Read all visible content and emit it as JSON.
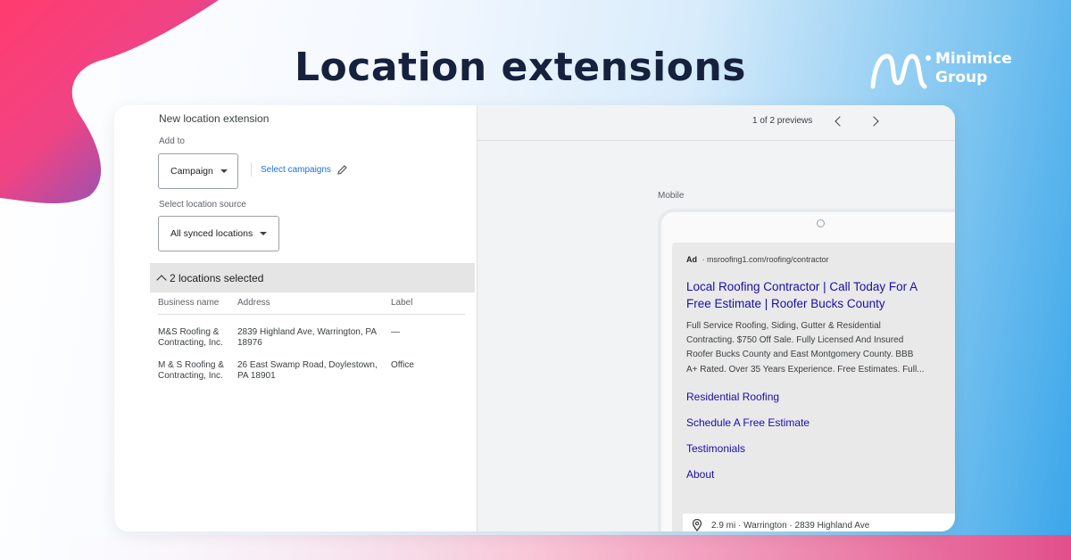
{
  "headline": "Location extensions",
  "brand": {
    "line1": "Minimice",
    "line2": "Group"
  },
  "left_panel": {
    "title": "New location extension",
    "add_to_label": "Add to",
    "campaign_dropdown": "Campaign",
    "select_campaigns_link": "Select campaigns",
    "location_source_label": "Select location source",
    "location_source_dropdown": "All synced locations",
    "locations_selected": "2 locations selected",
    "table": {
      "headers": [
        "Business name",
        "Address",
        "Label"
      ],
      "rows": [
        {
          "name_l1": "M&S Roofing &",
          "name_l2": "Contracting, Inc.",
          "addr_l1": "2839 Highland Ave, Warrington, PA",
          "addr_l2": "18976",
          "label": "—"
        },
        {
          "name_l1": "M & S Roofing &",
          "name_l2": "Contracting, Inc.",
          "addr_l1": "26 East Swamp Road, Doylestown,",
          "addr_l2": "PA 18901",
          "label": "Office"
        }
      ]
    }
  },
  "right_panel": {
    "preview_counter": "1 of 2 previews",
    "device_label": "Mobile",
    "ad": {
      "badge": "Ad",
      "url": "· msroofing1.com/roofing/contractor",
      "headline_l1": "Local Roofing Contractor | Call Today For A",
      "headline_l2": "Free Estimate | Roofer Bucks County",
      "desc_l1": "Full Service Roofing, Siding, Gutter & Residential",
      "desc_l2": "Contracting. $750 Off Sale. Fully Licensed And Insured",
      "desc_l3": "Roofer Bucks County and East Montgomery County. BBB",
      "desc_l4": "A+ Rated. Over 35 Years Experience. Free Estimates. Full...",
      "sitelinks": [
        "Residential Roofing",
        "Schedule A Free Estimate",
        "Testimonials",
        "About"
      ],
      "location": "2.9 mi · Warrington · 2839 Highland Ave"
    }
  },
  "colors": {
    "headline": "#16213e",
    "link_blue": "#1a73e8",
    "ad_link": "#1a0dab",
    "accent_pink": "#f0407a",
    "accent_purple": "#6a5bd6"
  },
  "icons": [
    "pencil-icon",
    "chevron-up-icon",
    "chevron-left-icon",
    "chevron-right-icon",
    "location-pin-icon",
    "dropdown-caret-icon"
  ]
}
